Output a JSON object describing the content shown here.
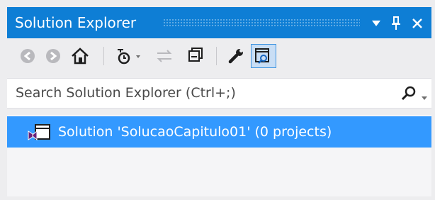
{
  "window": {
    "title": "Solution Explorer"
  },
  "toolbar": {
    "buttons": [
      {
        "name": "back-icon"
      },
      {
        "name": "forward-icon"
      },
      {
        "name": "home-icon"
      },
      {
        "name": "pending-changes-icon"
      },
      {
        "name": "sync-icon"
      },
      {
        "name": "collapse-all-icon"
      },
      {
        "name": "properties-wrench-icon"
      },
      {
        "name": "preview-selected-icon",
        "active": true
      }
    ]
  },
  "search": {
    "placeholder": "Search Solution Explorer (Ctrl+;)"
  },
  "tree": {
    "items": [
      {
        "label": "Solution 'SolucaoCapitulo01' (0 projects)",
        "selected": true
      }
    ]
  },
  "colors": {
    "titlebar": "#0e7ed5",
    "selection": "#3399ff",
    "background": "#ededef"
  }
}
